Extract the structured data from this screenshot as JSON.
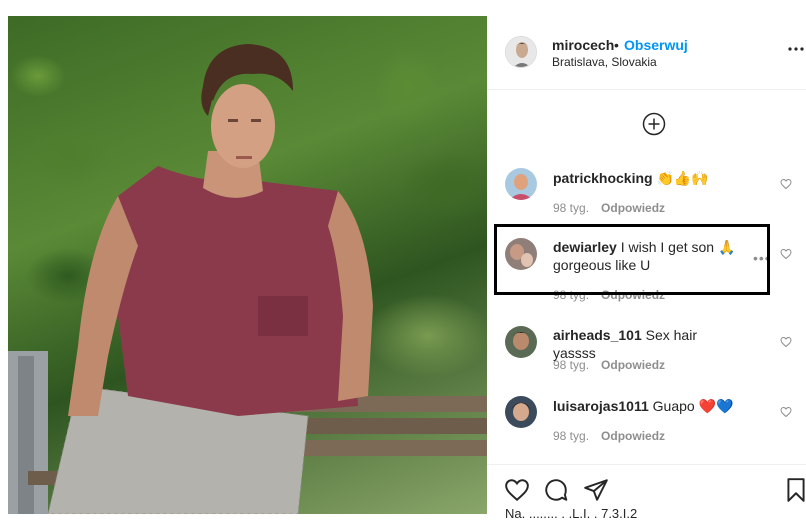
{
  "post": {
    "username": "mirocech",
    "separator": "•",
    "follow_label": "Obserwuj",
    "location": "Bratislava, Slovakia"
  },
  "comments": [
    {
      "username": "patrickhocking",
      "text": "👏👍🙌",
      "age": "98 tyg.",
      "reply": "Odpowiedz"
    },
    {
      "username": "dewiarley",
      "text": "I wish I get son 🙏 gorgeous like U",
      "age": "98 tyg.",
      "reply": "Odpowiedz"
    },
    {
      "username": "airheads_101",
      "text": "Sex hair yassss",
      "age": "98 tyg.",
      "reply": "Odpowiedz"
    },
    {
      "username": "luisarojas1011",
      "text": "Guapo ❤️💙",
      "age": "98 tyg.",
      "reply": "Odpowiedz"
    }
  ],
  "icons": {
    "more": "more-horizontal-icon",
    "load_more": "plus-circle-icon",
    "like": "heart-icon",
    "comment": "comment-icon",
    "share": "send-icon",
    "save": "bookmark-icon"
  },
  "colors": {
    "accent": "#0095f6",
    "text": "#262626",
    "muted": "#8e8e8e",
    "heart_red": "#ed4956",
    "heart_blue": "#3ec6f2"
  },
  "likes_truncated": "Na. ........ . .L.I. . 7.3.I.2"
}
